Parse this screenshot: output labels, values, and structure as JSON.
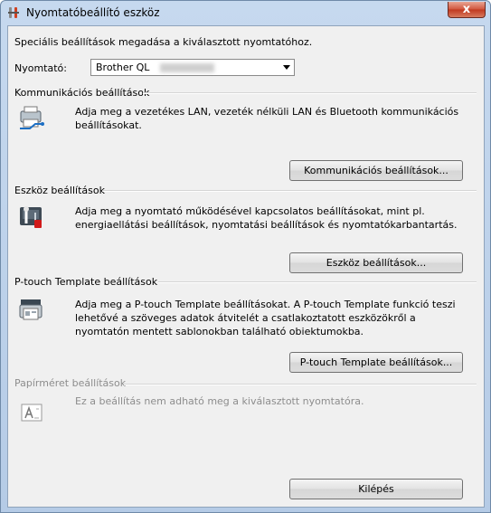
{
  "window": {
    "title": "Nyomtatóbeállító eszköz",
    "close_symbol": "x"
  },
  "intro": "Speciális beállítások megadása a kiválasztott nyomtatóhoz.",
  "printer": {
    "label": "Nyomtató:",
    "value": "Brother QL"
  },
  "sections": {
    "communication": {
      "title": "Kommunikációs beállítások",
      "description": "Adja meg a vezetékes LAN, vezeték nélküli LAN és Bluetooth kommunikációs beállításokat.",
      "button": "Kommunikációs beállítások...",
      "icon": "network-printer-icon"
    },
    "device": {
      "title": "Eszköz beállítások",
      "description": "Adja meg a nyomtató működésével kapcsolatos beállításokat, mint pl. energiaellátási beállítások, nyomtatási beállítások és nyomtatókarbantartás.",
      "button": "Eszköz beállítások...",
      "icon": "tools-icon"
    },
    "ptouch": {
      "title": "P-touch Template beállítások",
      "description": "Adja meg a P-touch Template beállításokat. A P-touch Template funkció teszi lehetővé a szöveges adatok átvitelét a csatlakoztatott eszközökről a nyomtatón mentett sablonokban található obiektumokba.",
      "button": "P-touch Template beállítások...",
      "icon": "template-printer-icon"
    },
    "paper": {
      "title": "Papírméret beállítások",
      "description": "Ez a beállítás nem adható meg a kiválasztott nyomtatóra.",
      "icon": "paper-size-icon"
    }
  },
  "exit_button": "Kilépés"
}
